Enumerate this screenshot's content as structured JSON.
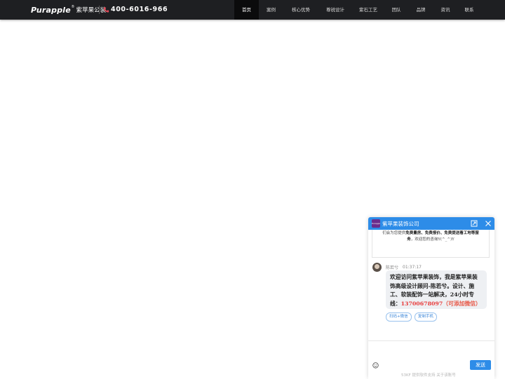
{
  "header": {
    "logo_text": "Purapple",
    "logo_reg": "®",
    "logo_cn": "紫苹果公装",
    "phone": "400-6016-966",
    "phone_icon": "phone-icon",
    "nav": [
      {
        "label": "首页",
        "active": true
      },
      {
        "label": "案例",
        "active": false
      },
      {
        "label": "核心优势",
        "active": false
      },
      {
        "label": "尊锐设计",
        "active": false
      },
      {
        "label": "紫石工艺",
        "active": false
      },
      {
        "label": "团队",
        "active": false
      },
      {
        "label": "品牌",
        "active": false
      },
      {
        "label": "资讯",
        "active": false
      },
      {
        "label": "联系",
        "active": false
      }
    ]
  },
  "chat": {
    "logo_text": "Purapple",
    "title": "紫苹果装饰公司",
    "notice": {
      "line1_pre": "们会为您提供",
      "line1_bold": "免费量房、免费报价、免费提送看工地等服",
      "line2_bold": "务",
      "line2_post": "，欢迎您的咨询Y(^_^)Y"
    },
    "agent_name": "陈若兮",
    "agent_time": "01:37:17",
    "message": {
      "text": "欢迎访问紫苹果装饰，我是紫苹果装饰高级设计顾问-陈若兮。设计、施工、软装配饰一站解决，24小时专线：",
      "phone": "13700678097",
      "suffix": "（可添加微信）"
    },
    "quick_replies": [
      "扫码+微信",
      "复制手机"
    ],
    "send_label": "发送",
    "footer": "53KF 提供软件支持  关于该账号"
  },
  "colors": {
    "topbar": "#1e1f22",
    "chat_accent": "#2d8ce8",
    "phone_highlight": "#e83a3a"
  }
}
